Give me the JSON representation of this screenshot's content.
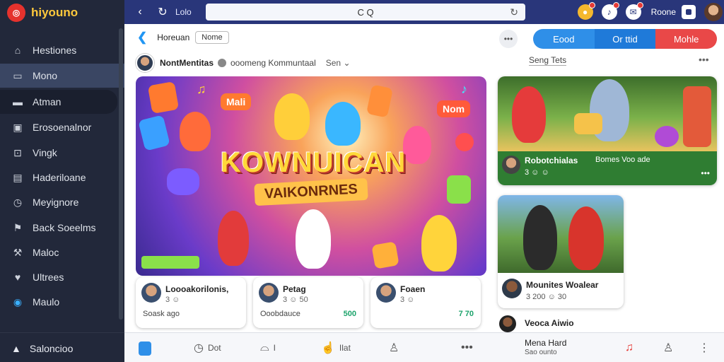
{
  "brand": {
    "logo_badge": "🎯",
    "name": "hiyouno"
  },
  "sidebar": {
    "items": [
      {
        "label": "Hestiones",
        "icon": "home-icon"
      },
      {
        "label": "Mono",
        "icon": "window-icon"
      },
      {
        "label": "Atman",
        "icon": "card-icon"
      },
      {
        "label": "Erosoenalnor",
        "icon": "media-icon"
      },
      {
        "label": "Vingk",
        "icon": "bookmark-icon"
      },
      {
        "label": "Haderiloane",
        "icon": "doc-icon"
      },
      {
        "label": "Meyignore",
        "icon": "clock-icon"
      },
      {
        "label": "Back Soeelms",
        "icon": "flag-icon"
      },
      {
        "label": "Maloc",
        "icon": "wrench-icon"
      },
      {
        "label": "Ultrees",
        "icon": "heart-icon"
      },
      {
        "label": "Maulo",
        "icon": "globe-icon"
      }
    ],
    "footer_label": "Saloncioo"
  },
  "topbar": {
    "label": "Lolo",
    "url": "C Q",
    "user": "Roone"
  },
  "subhead": {
    "crumb": "Horeuan",
    "chip": "Nome",
    "tabs": [
      "Eood",
      "Or ttid",
      "Mohle"
    ]
  },
  "poster": {
    "name": "NontMentitas",
    "group": "ooomeng Kommuntaal",
    "sort": "Sen"
  },
  "hero": {
    "title": "KOWNUICAN",
    "subtitle": "VAIKONRNES",
    "tag1": "Mali",
    "tag2": "Nom"
  },
  "mini_cards": [
    {
      "name": "Loooakorilonis,",
      "meta": "3 ☺",
      "foot": "Soask ago",
      "stat": ""
    },
    {
      "name": "Petag",
      "meta": "3 ☺ 50",
      "foot": "Ooobdauce",
      "stat": "500"
    },
    {
      "name": "Foaen",
      "meta": "3 ☺",
      "foot": "",
      "stat": "7 70"
    }
  ],
  "right": {
    "heading": "Seng Tets",
    "card_a": {
      "title": "Robotchialas",
      "detail": "Bomes Voo ade",
      "meta": "3 ☺ ☺"
    },
    "card_b": {
      "title": "Mounites Woalear",
      "meta": "3 200 ☺ 30"
    },
    "teaser": "Veoca Aiwio"
  },
  "bottombar": {
    "items": [
      "Dot",
      "I",
      "Ilat",
      "",
      "Mena Hard",
      "Sao ounto"
    ]
  }
}
